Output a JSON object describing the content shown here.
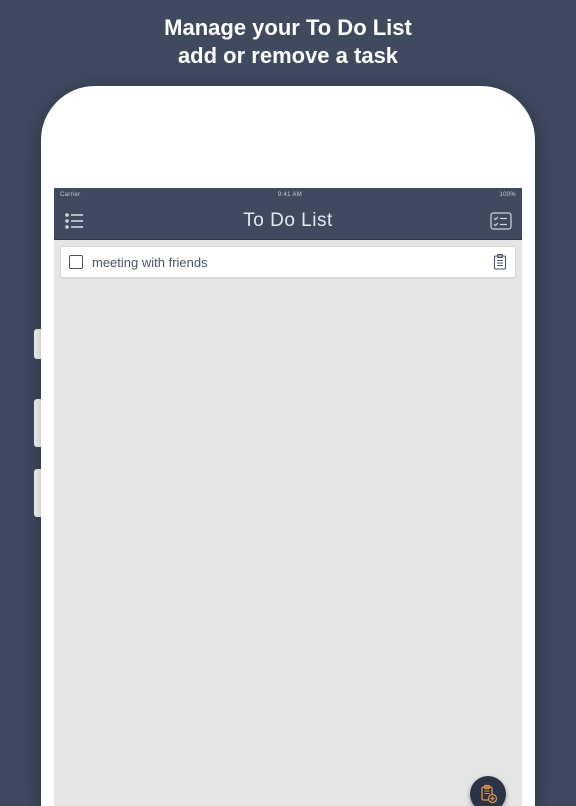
{
  "promo": {
    "line1": "Manage your To Do List",
    "line2": "add or remove a task"
  },
  "statusbar": {
    "left": "Carrier",
    "center": "9:41 AM",
    "right": "100%"
  },
  "navbar": {
    "title": "To Do List"
  },
  "tasks": [
    {
      "label": "meeting with friends",
      "checked": false
    }
  ]
}
